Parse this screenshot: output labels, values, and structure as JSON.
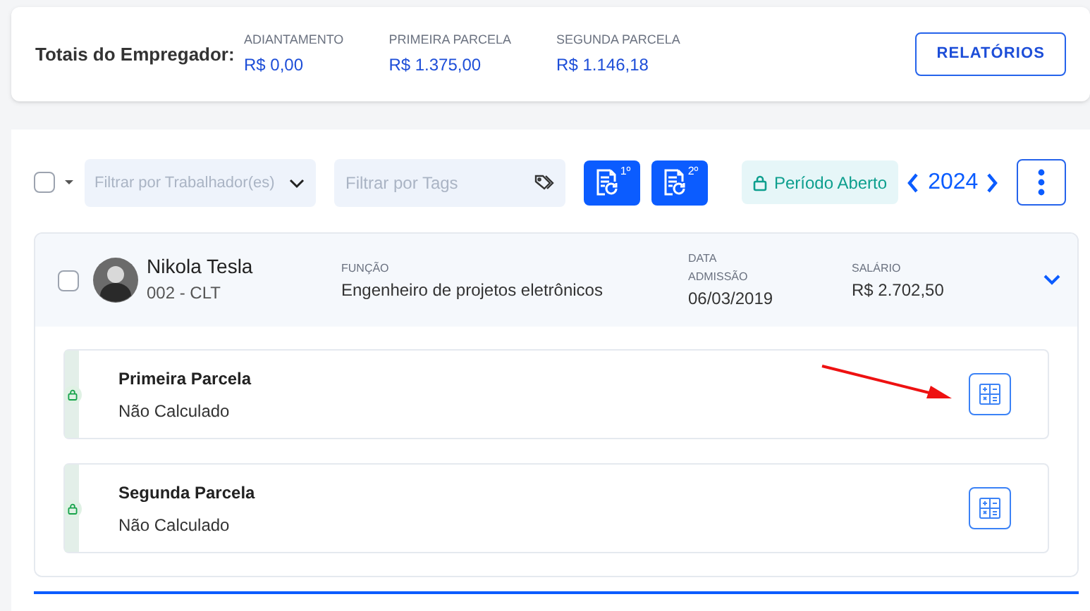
{
  "totals": {
    "label": "Totais do Empregador:",
    "items": [
      {
        "label": "ADIANTAMENTO",
        "value": "R$ 0,00"
      },
      {
        "label": "PRIMEIRA PARCELA",
        "value": "R$ 1.375,00"
      },
      {
        "label": "SEGUNDA PARCELA",
        "value": "R$ 1.146,18"
      }
    ],
    "button": "RELATÓRIOS"
  },
  "toolbar": {
    "select_all": {
      "checked": false
    },
    "worker_filter": {
      "placeholder": "Filtrar por Trabalhador(es)"
    },
    "tag_filter": {
      "placeholder": "Filtrar por Tags"
    },
    "recalc_buttons": [
      "1º",
      "2º"
    ],
    "period": "Período Aberto",
    "year": "2024"
  },
  "employee": {
    "checked": false,
    "expanded": true,
    "name": "Nikola Tesla",
    "code": "002 - CLT",
    "fields": [
      {
        "label": "FUNÇÃO",
        "value": "Engenheiro de projetos eletrônicos"
      },
      {
        "label": "DATA ADMISSÃO",
        "value": "06/03/2019"
      },
      {
        "label": "SALÁRIO",
        "value": "R$ 2.702,50"
      }
    ]
  },
  "parcels": [
    {
      "title": "Primeira Parcela",
      "status": "Não Calculado",
      "locked": true
    },
    {
      "title": "Segunda Parcela",
      "status": "Não Calculado",
      "locked": true
    }
  ]
}
